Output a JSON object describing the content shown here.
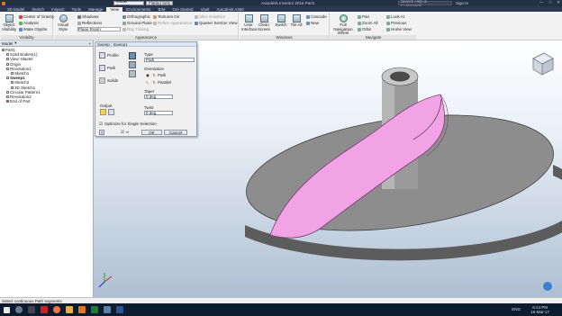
{
  "titlebar": {
    "doc_select": "Model Copper",
    "doc_select2": "Flatted Sets",
    "app_title": "Autodesk Inventor 2016   Part1",
    "search_placeholder": "Search Help & Commands...",
    "signin": "Sign In",
    "win_min": "—",
    "win_max": "□",
    "win_close": "✕"
  },
  "tabs": [
    "3D Model",
    "Sketch",
    "Inspect",
    "Tools",
    "Manage",
    "View",
    "Environments",
    "BIM",
    "Get Started",
    "Vault",
    "Autodesk A360"
  ],
  "active_tab": "View",
  "ribbon": {
    "visibility": {
      "label": "Visibility",
      "object_vis": "Object Visibility",
      "cog": "Center of Gravity",
      "analysis": "Analysis",
      "glyphs": "iMate Glyphs"
    },
    "appearance": {
      "label": "Appearance",
      "visual_style": "Visual Style",
      "shadows": "Shadows",
      "reflections": "Reflections",
      "plane_room": "Plane Room",
      "orthographic": "Orthographic",
      "ground_plane": "Ground Plane",
      "ray_tracing": "Ray Tracing",
      "textures_on": "Textures On",
      "refine_appearance": "Refine Appearance",
      "slice_graphics": "Slice Graphics",
      "quarter_section": "Quarter Section View"
    },
    "windows": {
      "label": "Windows",
      "user_interface": "User Interface",
      "clean_screen": "Clean Screen",
      "switch": "Switch",
      "tile_all": "Tile All",
      "cascade": "Cascade",
      "new": "New"
    },
    "navigate": {
      "label": "Navigate",
      "full_nav_wheel": "Full Navigation Wheel",
      "pan": "Pan",
      "zoom_all": "Zoom All",
      "orbit": "Orbit",
      "look_at": "Look At",
      "previous": "Previous",
      "home_view": "Home View"
    }
  },
  "browser": {
    "header": "Model",
    "items": [
      {
        "label": "Part1",
        "indent": 0
      },
      {
        "label": "Solid Bodies(1)",
        "indent": 1
      },
      {
        "label": "View: Master",
        "indent": 1
      },
      {
        "label": "Origin",
        "indent": 1
      },
      {
        "label": "Revolution1",
        "indent": 1
      },
      {
        "label": "Sketch1",
        "indent": 2
      },
      {
        "label": "Sweep1",
        "indent": 1
      },
      {
        "label": "Sketch2",
        "indent": 2
      },
      {
        "label": "3D Sketch1",
        "indent": 2
      },
      {
        "label": "Circular Pattern1",
        "indent": 1
      },
      {
        "label": "Revolution2",
        "indent": 1
      },
      {
        "label": "End of Part",
        "indent": 1
      }
    ]
  },
  "dialog": {
    "title": "Sweep : Sweep1",
    "profile": "Profile",
    "path": "Path",
    "solids": "Solids",
    "output": "Output",
    "type_label": "Type",
    "type_value": "Path",
    "orientation_label": "Orientation",
    "opt_path": "Path",
    "opt_parallel": "Parallel",
    "taper_label": "Taper",
    "taper_value": "0 deg",
    "twist_label": "Twist",
    "twist_value": "0 deg",
    "optimize": "Optimize for Single Selection",
    "ok": "OK",
    "cancel": "Cancel"
  },
  "status": "Select continuous Path segments",
  "taskbar": {
    "lang": "ENG",
    "time": "8:14 PM",
    "date": "16-Mar-17"
  },
  "colors": {
    "sweep": "#f2a3e6",
    "taskbar": "#0c1b2e",
    "ribbon": "#f2f2f2"
  }
}
